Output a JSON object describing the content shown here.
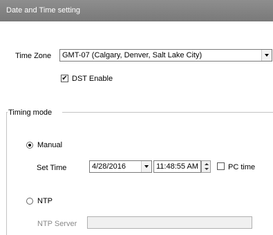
{
  "header": {
    "title": "Date and Time setting"
  },
  "time_zone": {
    "label": "Time Zone",
    "selected": "GMT-07 (Calgary, Denver, Salt Lake City)"
  },
  "dst": {
    "label": "DST Enable",
    "checked_glyph": "✔"
  },
  "timing_mode": {
    "legend": "Timing mode",
    "manual_label": "Manual",
    "set_time_label": "Set Time",
    "date_value": "4/28/2016",
    "time_value": "11:48:55 AM",
    "pc_time_label": "PC time",
    "ntp_label": "NTP",
    "ntp_server_label": "NTP Server",
    "ntp_server_value": ""
  }
}
